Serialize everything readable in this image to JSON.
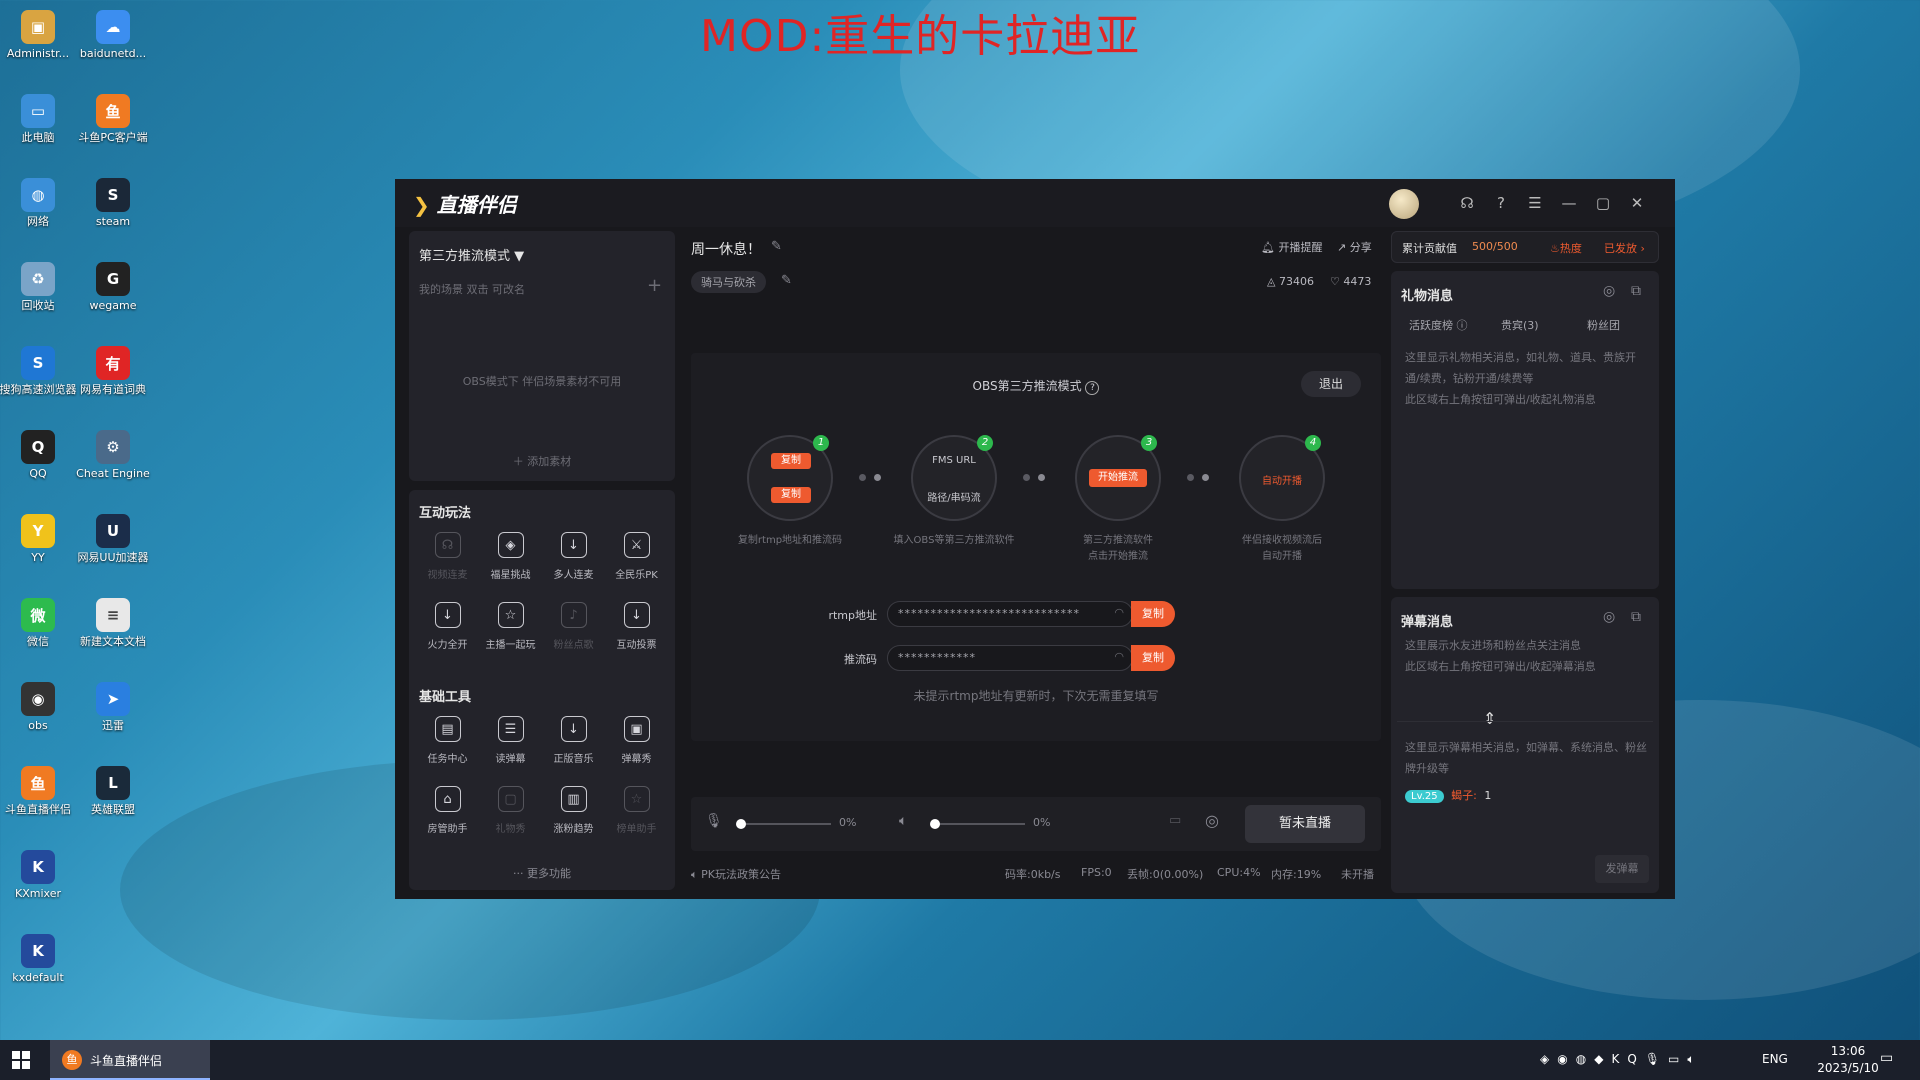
{
  "overlay": {
    "mod_title": "MOD:重生的卡拉迪亚"
  },
  "desktop": {
    "col1": [
      {
        "label": "Administr...",
        "icon": "folder-user-icon",
        "color": "#d9a441",
        "glyph": "▣"
      },
      {
        "label": "此电脑",
        "icon": "computer-icon",
        "color": "#3a8fd8",
        "glyph": "▭"
      },
      {
        "label": "网络",
        "icon": "network-icon",
        "color": "#3a8fd8",
        "glyph": "◍"
      },
      {
        "label": "回收站",
        "icon": "recycle-bin-icon",
        "color": "#7aa4c8",
        "glyph": "♻"
      },
      {
        "label": "搜狗高速浏览器",
        "icon": "sogou-browser-icon",
        "color": "#1f77d4",
        "glyph": "S"
      },
      {
        "label": "QQ",
        "icon": "qq-icon",
        "color": "#222",
        "glyph": "Q"
      },
      {
        "label": "YY",
        "icon": "yy-icon",
        "color": "#f0c21b",
        "glyph": "Y"
      },
      {
        "label": "微信",
        "icon": "wechat-icon",
        "color": "#2dbb4e",
        "glyph": "微"
      },
      {
        "label": "obs",
        "icon": "obs-icon",
        "color": "#333",
        "glyph": "◉"
      },
      {
        "label": "斗鱼直播伴侣",
        "icon": "douyu-companion-icon",
        "color": "#f07a22",
        "glyph": "鱼"
      },
      {
        "label": "KXmixer",
        "icon": "kxmixer-icon",
        "color": "#244a9c",
        "glyph": "K"
      },
      {
        "label": "kxdefault",
        "icon": "kxdefault-icon",
        "color": "#244a9c",
        "glyph": "K"
      }
    ],
    "col2": [
      {
        "label": "baidunetd...",
        "icon": "baidunetdisk-icon",
        "color": "#3c8ef0",
        "glyph": "☁"
      },
      {
        "label": "斗鱼PC客户端",
        "icon": "douyu-pc-icon",
        "color": "#f07a22",
        "glyph": "鱼"
      },
      {
        "label": "steam",
        "icon": "steam-icon",
        "color": "#1b2838",
        "glyph": "S"
      },
      {
        "label": "wegame",
        "icon": "wegame-icon",
        "color": "#222",
        "glyph": "G"
      },
      {
        "label": "网易有道词典",
        "icon": "youdao-icon",
        "color": "#e02525",
        "glyph": "有"
      },
      {
        "label": "Cheat Engine",
        "icon": "cheat-engine-icon",
        "color": "#4a6a8a",
        "glyph": "⚙"
      },
      {
        "label": "网易UU加速器",
        "icon": "uu-accelerator-icon",
        "color": "#1b2d4a",
        "glyph": "U"
      },
      {
        "label": "新建文本文档",
        "icon": "text-document-icon",
        "color": "#e8e8e8",
        "glyph": "≡"
      },
      {
        "label": "迅雷",
        "icon": "xunlei-icon",
        "color": "#2a7fe0",
        "glyph": "➤"
      },
      {
        "label": "英雄联盟",
        "icon": "lol-icon",
        "color": "#1a2a3a",
        "glyph": "L"
      }
    ]
  },
  "app": {
    "title": "直播伴侣",
    "left": {
      "mode": "第三方推流模式",
      "scene_hint": "我的场景  双击 可改名",
      "obs_notice": "OBS模式下 伴侣场景素材不可用",
      "add_material": "添加素材",
      "interactive_title": "互动玩法",
      "interactive": [
        {
          "label": "视频连麦",
          "icon": "video-link-icon",
          "glyph": "☊",
          "enabled": false
        },
        {
          "label": "福星挑战",
          "icon": "lucky-star-icon",
          "glyph": "◈",
          "enabled": true
        },
        {
          "label": "多人连麦",
          "icon": "multi-link-icon",
          "glyph": "↓",
          "enabled": true
        },
        {
          "label": "全民乐PK",
          "icon": "pk-icon",
          "glyph": "⚔",
          "enabled": true
        },
        {
          "label": "火力全开",
          "icon": "firepower-icon",
          "glyph": "↓",
          "enabled": true
        },
        {
          "label": "主播一起玩",
          "icon": "play-together-icon",
          "glyph": "☆",
          "enabled": true
        },
        {
          "label": "粉丝点歌",
          "icon": "fan-song-icon",
          "glyph": "♪",
          "enabled": false
        },
        {
          "label": "互动投票",
          "icon": "vote-icon",
          "glyph": "↓",
          "enabled": true
        }
      ],
      "tools_title": "基础工具",
      "tools": [
        {
          "label": "任务中心",
          "icon": "task-center-icon",
          "glyph": "▤",
          "enabled": true
        },
        {
          "label": "读弹幕",
          "icon": "read-danmaku-icon",
          "glyph": "☰",
          "enabled": true
        },
        {
          "label": "正版音乐",
          "icon": "music-icon",
          "glyph": "↓",
          "enabled": true
        },
        {
          "label": "弹幕秀",
          "icon": "danmaku-show-icon",
          "glyph": "▣",
          "enabled": true
        },
        {
          "label": "房管助手",
          "icon": "room-manager-icon",
          "glyph": "⌂",
          "enabled": true
        },
        {
          "label": "礼物秀",
          "icon": "gift-show-icon",
          "glyph": "▢",
          "enabled": false
        },
        {
          "label": "涨粉趋势",
          "icon": "fan-trend-icon",
          "glyph": "▥",
          "enabled": true
        },
        {
          "label": "榜单助手",
          "icon": "rank-helper-icon",
          "glyph": "☆",
          "enabled": false
        }
      ],
      "more": "更多功能"
    },
    "center": {
      "room_title": "周一休息！",
      "category": "骑马与砍杀",
      "open_reminder": "开播提醒",
      "share": "分享",
      "heat": "73406",
      "likes": "4473",
      "obs_mode": "OBS第三方推流模式",
      "exit": "退出",
      "step1_copy1": "复制",
      "step1_copy2": "复制",
      "step1_caption": "复制rtmp地址和推流码",
      "step2_l1": "FMS URL",
      "step2_l2": "路径/串码流",
      "step2_caption": "填入OBS等第三方推流软件",
      "step3_btn": "开始推流",
      "step3_caption": "第三方推流软件\n点击开始推流",
      "step4_text": "自动开播",
      "step4_caption": "伴侣接收视频流后\n自动开播",
      "rtmp_label": "rtmp地址",
      "rtmp_value": "****************************",
      "key_label": "推流码",
      "key_value": "************",
      "copy": "复制",
      "hint": "未提示rtmp地址有更新时，下次无需重复填写",
      "mic_level": "0%",
      "speaker_level": "0%",
      "mic_fraction": 0.0,
      "speaker_fraction": 0.0,
      "go_live": "暂未直播",
      "announcement": "PK玩法政策公告",
      "status": {
        "bitrate": "码率:0kb/s",
        "fps": "FPS:0",
        "drop": "丢帧:0(0.00%)",
        "cpu": "CPU:4%",
        "mem": "内存:19%",
        "live": "未开播"
      }
    },
    "right": {
      "contrib_label": "累计贡献值",
      "contrib_value": "500/500",
      "hot": "热度",
      "issued": "已发放",
      "gift_title": "礼物消息",
      "gift_tabs": [
        "活跃度榜",
        "贵宾(3)",
        "粉丝团"
      ],
      "gift_msg": "这里显示礼物相关消息，如礼物、道具、贵族开通/续费，钻粉开通/续费等\n此区域右上角按钮可弹出/收起礼物消息",
      "danmaku_title": "弹幕消息",
      "danmaku_msg": "这里展示水友进场和粉丝点关注消息\n此区域右上角按钮可弹出/收起弹幕消息",
      "danmaku_msg2": "这里显示弹幕相关消息，如弹幕、系统消息、粉丝牌升级等",
      "badge": "Lv.25",
      "user": "蝎子:",
      "user_msg": "1",
      "send": "发弹幕"
    }
  },
  "taskbar": {
    "app_label": "斗鱼直播伴侣",
    "lang": "ENG",
    "time": "13:06",
    "date": "2023/5/10"
  }
}
